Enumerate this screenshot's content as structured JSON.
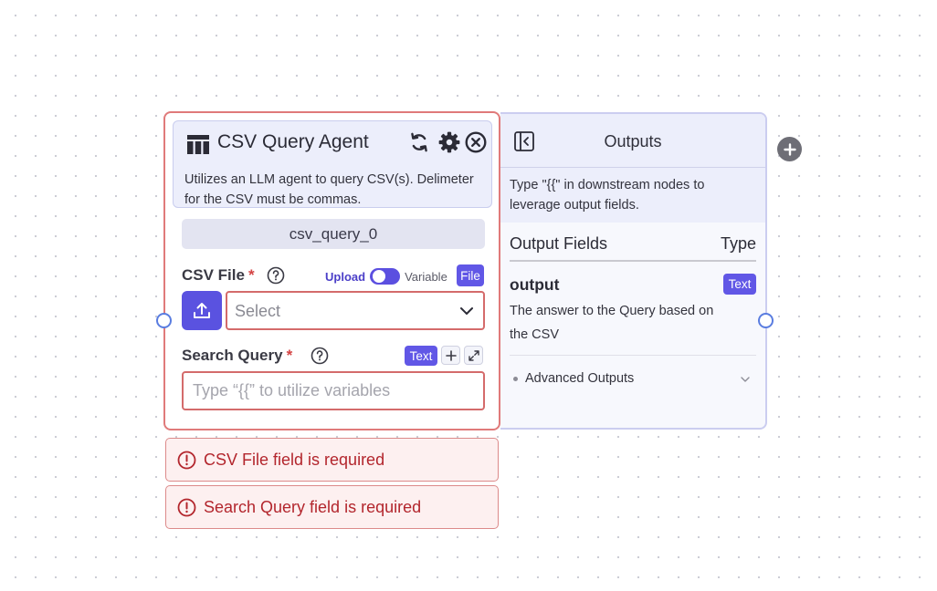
{
  "node": {
    "title": "CSV Query Agent",
    "description": "Utilizes an LLM agent to query CSV(s). Delimeter for the CSV must be commas.",
    "id_label": "csv_query_0",
    "csv_field": {
      "label": "CSV File",
      "required_mark": "*",
      "toggle_left": "Upload",
      "toggle_right": "Variable",
      "badge": "File",
      "select_value": "Select"
    },
    "query_field": {
      "label": "Search Query",
      "required_mark": "*",
      "badge": "Text",
      "placeholder": "Type “{{” to utilize variables"
    }
  },
  "outputs": {
    "title": "Outputs",
    "note": "Type \"{{\" in downstream nodes to leverage output fields.",
    "col_left": "Output Fields",
    "col_right": "Type",
    "field": {
      "name": "output",
      "type_badge": "Text",
      "description": "The answer to the Query based on the CSV"
    },
    "advanced_label": "Advanced Outputs"
  },
  "errors": [
    "CSV File field is required",
    "Search Query field is required"
  ],
  "colors": {
    "accent": "#5a52e0",
    "error": "#b3262d",
    "node_border": "#e07a7a"
  }
}
